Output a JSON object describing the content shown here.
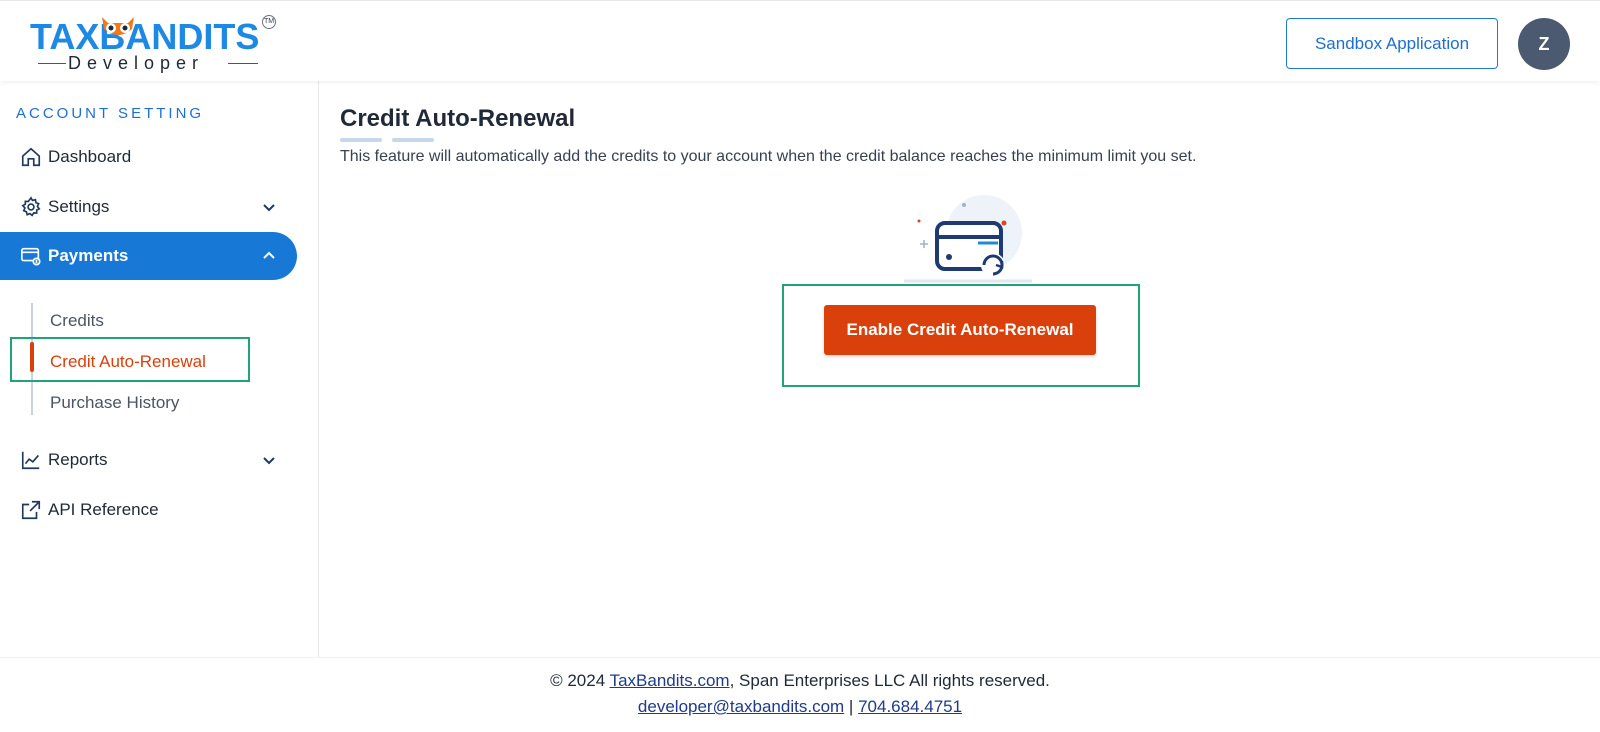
{
  "header": {
    "logo_text": "TAXBANDITS",
    "logo_sub": "Developer",
    "logo_tm": "TM",
    "sandbox_button": "Sandbox Application",
    "avatar_initial": "Z"
  },
  "sidebar": {
    "heading": "ACCOUNT SETTING",
    "items": [
      {
        "label": "Dashboard",
        "icon": "home-icon"
      },
      {
        "label": "Settings",
        "icon": "gear-icon"
      },
      {
        "label": "Payments",
        "icon": "payment-card-icon"
      },
      {
        "label": "Reports",
        "icon": "chart-line-icon"
      },
      {
        "label": "API Reference",
        "icon": "external-link-icon"
      }
    ],
    "payments_sub": [
      {
        "label": "Credits"
      },
      {
        "label": "Credit Auto-Renewal"
      },
      {
        "label": "Purchase History"
      }
    ]
  },
  "main": {
    "title": "Credit Auto-Renewal",
    "description": "This feature will automatically add the credits to your account when the credit balance reaches the minimum limit you set.",
    "cta_button": "Enable Credit Auto-Renewal",
    "illustration_icon": "card-renewal-icon"
  },
  "footer": {
    "copyright_prefix": "© 2024",
    "site_link": "TaxBandits.com",
    "copyright_suffix": ", Span Enterprises LLC All rights reserved.",
    "email": "developer@taxbandits.com",
    "separator": "|",
    "phone": "704.684.4751"
  },
  "colors": {
    "accent": "#1878d6",
    "cta": "#d9400b",
    "highlight": "#21a37a"
  }
}
